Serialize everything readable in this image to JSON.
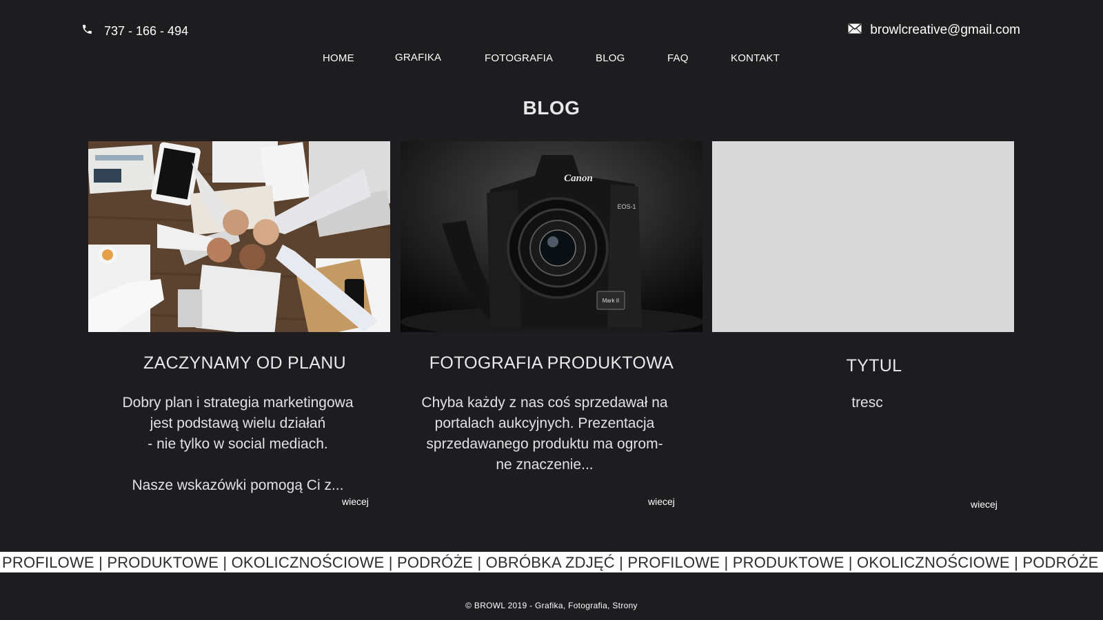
{
  "header": {
    "phone": "737 - 166 - 494",
    "phone_icon": "phone-icon",
    "email": "browlcreative@gmail.com",
    "email_icon": "envelope-icon"
  },
  "nav": {
    "items": [
      {
        "label": "HOME"
      },
      {
        "label": "GRAFIKA"
      },
      {
        "label": "FOTOGRAFIA"
      },
      {
        "label": "BLOG"
      },
      {
        "label": "FAQ"
      },
      {
        "label": "KONTAKT"
      }
    ]
  },
  "page": {
    "title": "BLOG"
  },
  "posts": [
    {
      "title": "ZACZYNAMY OD PLANU",
      "text": "Dobry plan i strategia marketingowa\njest podstawą wielu działań\n- nie tylko w social mediach.\n\nNasze wskazówki pomogą Ci z...",
      "more": "wiecej",
      "image": "team-fist-bump-desk-photo"
    },
    {
      "title": "FOTOGRAFIA PRODUKTOWA",
      "text": "Chyba każdy z nas coś sprzedawał na\nportalach aukcyjnych. Prezentacja\nsprzedawanego produktu ma ogrom-\nne znaczenie...",
      "more": "wiecej",
      "image": "canon-camera-photo",
      "camera_brand": "Canon",
      "camera_model": "EOS-1",
      "camera_badge": "Mark II"
    },
    {
      "title": "TYTUL",
      "text": "tresc",
      "more": "wiecej",
      "image": "placeholder-gray"
    }
  ],
  "ticker": {
    "text": "PROFILOWE  |  PRODUKTOWE  |  OKOLICZNOŚCIOWE  |  PODRÓŻE  |  OBRÓBKA ZDJĘĆ  |  PROFILOWE  |  PRODUKTOWE  |  OKOLICZNOŚCIOWE  |  PODRÓŻE  |  OBRÓBKA ZDJĘĆ"
  },
  "footer": {
    "text": "©  BROWL 2019 - Grafika, Fotografia, Strony"
  },
  "colors": {
    "background": "#1d1d1f",
    "ticker_bg": "#ffffff",
    "placeholder": "#d9d9d9"
  }
}
